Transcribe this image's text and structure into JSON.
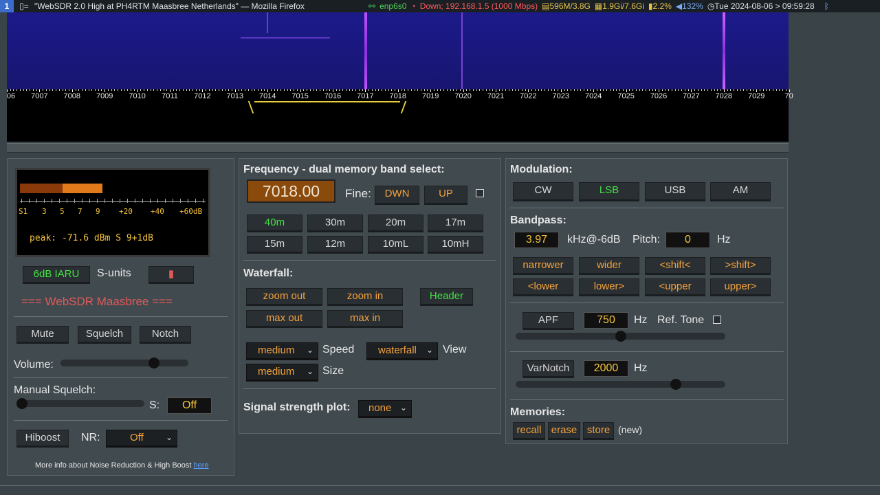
{
  "topbar": {
    "workspace": "1",
    "layout_icon": "▯=",
    "window_title": "\"WebSDR 2.0 High at PH4RTM Maasbree Netherlands\" — Mozilla Firefox",
    "net_iface": "enp6s0",
    "net_status": "Down; 192.168.1.5 (1000 Mbps)",
    "disk": "596M/3.8G",
    "mem": "1.9Gi/7.6Gi",
    "cpu": "2.2%",
    "volume": "132%",
    "datetime": "Tue 2024-08-06 > 09:59:28"
  },
  "scale": {
    "labels": [
      "06",
      "7007",
      "7008",
      "7009",
      "7010",
      "7011",
      "7012",
      "7013",
      "7014",
      "7015",
      "7016",
      "7017",
      "7018",
      "7019",
      "7020",
      "7021",
      "7022",
      "7023",
      "7024",
      "7025",
      "7026",
      "7027",
      "7028",
      "7029",
      "70"
    ]
  },
  "smeter": {
    "scale_labels": [
      "S1",
      "3",
      "5",
      "7",
      "9",
      "+20",
      "+40",
      "+60dB"
    ],
    "peak_text": "peak: -71.6 dBm   S 9+1dB"
  },
  "left": {
    "iaru_label": "6dB IARU",
    "sunits_label": "S-units",
    "site_title": "=== WebSDR Maasbree ===",
    "mute_label": "Mute",
    "squelch_label": "Squelch",
    "notch_label": "Notch",
    "volume_label": "Volume:",
    "manual_squelch_label": "Manual Squelch:",
    "s_label": "S:",
    "s_value": "Off",
    "hiboost_label": "Hiboost",
    "nr_label": "NR:",
    "nr_value": "Off",
    "info_text": "More info about Noise Reduction & High Boost",
    "info_link": "here",
    "volume_level": 0.75,
    "squelch_level": 0.0
  },
  "freq": {
    "title": "Frequency - dual memory band select:",
    "value": "7018.00",
    "fine_label": "Fine:",
    "dwn_label": "DWN",
    "up_label": "UP",
    "bands": [
      "40m",
      "30m",
      "20m",
      "17m",
      "15m",
      "12m",
      "10mL",
      "10mH"
    ],
    "active_band": "40m",
    "waterfall_title": "Waterfall:",
    "zoom_out": "zoom out",
    "zoom_in": "zoom in",
    "header": "Header",
    "max_out": "max out",
    "max_in": "max in",
    "speed_value": "medium",
    "speed_label": "Speed",
    "view_value": "waterfall",
    "view_label": "View",
    "size_value": "medium",
    "size_label": "Size",
    "ssplot_label": "Signal strength plot:",
    "ssplot_value": "none"
  },
  "mod": {
    "title": "Modulation:",
    "modes": [
      "CW",
      "LSB",
      "USB",
      "AM"
    ],
    "active_mode": "LSB",
    "bandpass_title": "Bandpass:",
    "bw_value": "3.97",
    "bw_unit": "kHz@-6dB",
    "pitch_label": "Pitch:",
    "pitch_value": "0",
    "hz": "Hz",
    "bp_buttons": [
      "narrower",
      "wider",
      "<shift<",
      ">shift>",
      "<lower",
      "lower>",
      "<upper",
      "upper>"
    ],
    "apf_label": "APF",
    "apf_value": "750",
    "reftone_label": "Ref. Tone",
    "varnotch_label": "VarNotch",
    "varnotch_value": "2000",
    "memories_title": "Memories:",
    "recall": "recall",
    "erase": "erase",
    "store": "store",
    "new_label": "(new)",
    "apf_level": 0.5,
    "varnotch_level": 0.78
  }
}
